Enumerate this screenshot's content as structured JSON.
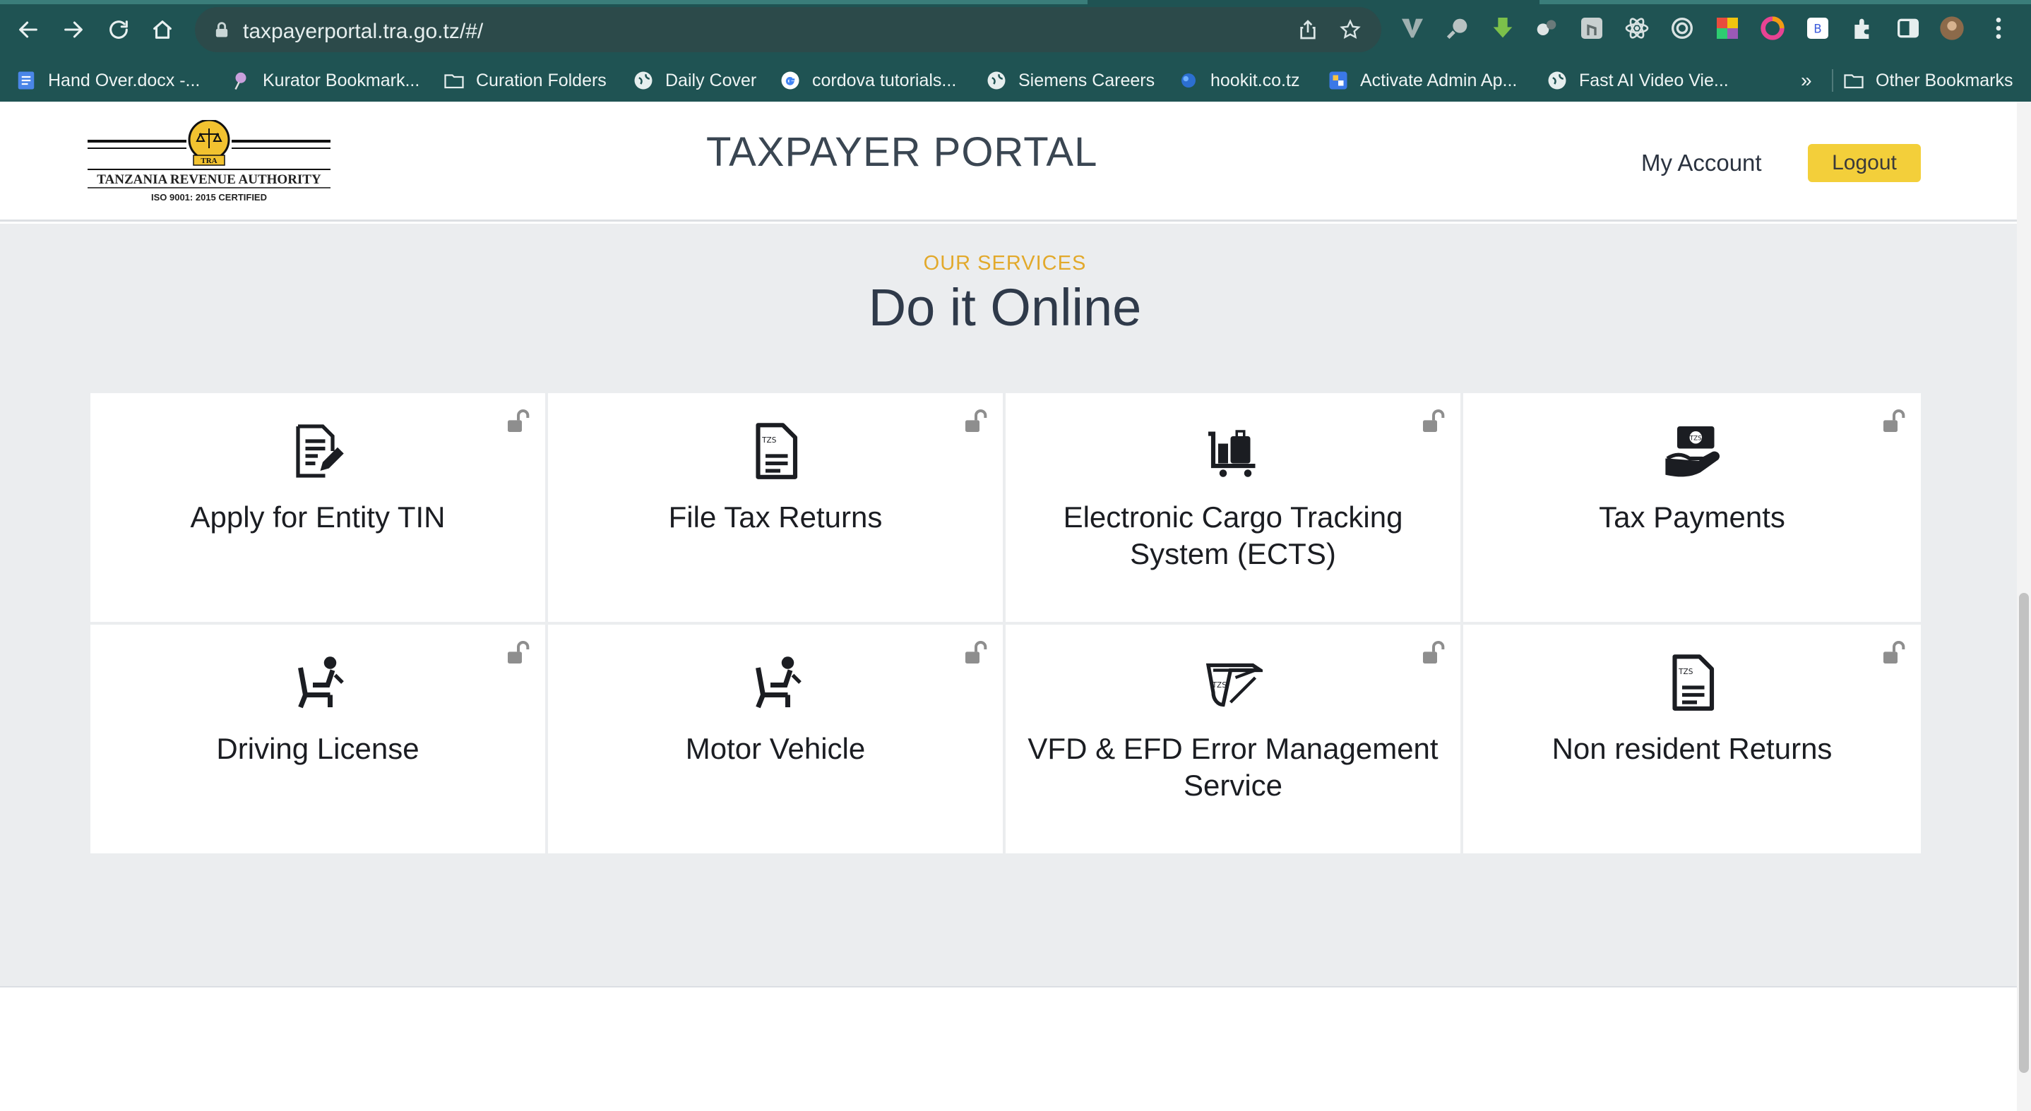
{
  "browser": {
    "url": "taxpayerportal.tra.go.tz/#/",
    "bookmarks": [
      {
        "label": "Hand Over.docx -...",
        "icon": "docs-icon"
      },
      {
        "label": "Kurator Bookmark...",
        "icon": "kurator-icon"
      },
      {
        "label": "Curation Folders",
        "icon": "folder-icon"
      },
      {
        "label": "Daily Cover",
        "icon": "globe-icon"
      },
      {
        "label": "cordova tutorials...",
        "icon": "google-icon"
      },
      {
        "label": "Siemens Careers",
        "icon": "globe-icon"
      },
      {
        "label": "hookit.co.tz",
        "icon": "hookit-icon"
      },
      {
        "label": "Activate Admin Ap...",
        "icon": "admin-icon"
      },
      {
        "label": "Fast AI Video Vie...",
        "icon": "globe-icon"
      }
    ],
    "more_bookmarks": "»",
    "other_bookmarks": "Other Bookmarks"
  },
  "header": {
    "logo_text": "TANZANIA REVENUE AUTHORITY",
    "logo_subtext": "ISO 9001: 2015 CERTIFIED",
    "logo_badge": "TRA",
    "title": "TAXPAYER PORTAL",
    "my_account": "My Account",
    "logout": "Logout"
  },
  "services": {
    "eyebrow": "OUR SERVICES",
    "heading": "Do it Online",
    "cards": [
      {
        "label": "Apply for Entity TIN",
        "icon": "document-edit-icon"
      },
      {
        "label": "File Tax Returns",
        "icon": "tax-document-icon"
      },
      {
        "label": "Electronic Cargo Tracking System (ECTS)",
        "icon": "cargo-trolley-icon"
      },
      {
        "label": "Tax Payments",
        "icon": "payment-hand-icon"
      },
      {
        "label": "Driving License",
        "icon": "driver-seat-icon"
      },
      {
        "label": "Motor Vehicle",
        "icon": "driver-seat-icon"
      },
      {
        "label": "VFD & EFD Error Management Service",
        "icon": "receipt-machine-icon"
      },
      {
        "label": "Non resident Returns",
        "icon": "tax-document-icon"
      }
    ],
    "icon_text": "TZS"
  },
  "colors": {
    "chrome": "#1f5353",
    "accent_yellow": "#f3cf3a",
    "eyebrow": "#e2a92b",
    "section_bg": "#ebedef"
  }
}
